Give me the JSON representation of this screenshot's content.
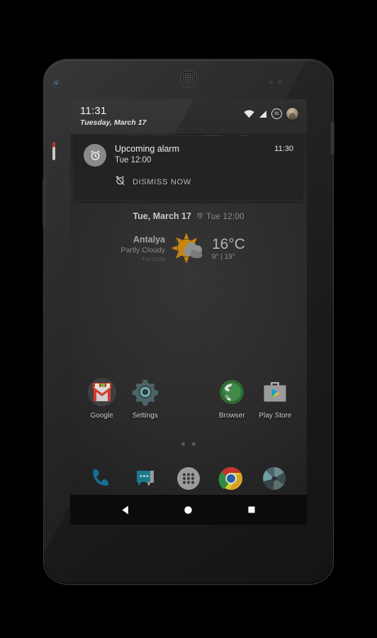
{
  "device": {
    "name": "nexus-5-phone",
    "hardware": [
      "front-camera",
      "earpiece-speaker",
      "proximity-sensor",
      "power-button",
      "volume-button",
      "notification-led"
    ]
  },
  "status_bar": {
    "time": "11:31",
    "date": "Tuesday, March 17",
    "icons": {
      "wifi": "wifi-icon",
      "signal": "cell-signal-icon",
      "battery": "battery-circle-icon",
      "battery_level": "91",
      "avatar": "user-avatar"
    }
  },
  "clock_widget": {
    "time": "11:31"
  },
  "notification": {
    "icon": "alarm-clock-icon",
    "title": "Upcoming alarm",
    "subtitle": "Tue 12:00",
    "timestamp": "11:30",
    "action_icon": "alarm-off-icon",
    "action_label": "DISMISS NOW"
  },
  "date_row": {
    "date": "Tue, March 17",
    "alarm_icon": "alarm-icon",
    "next_alarm": "Tue 12:00"
  },
  "weather": {
    "city": "Antalya",
    "condition": "Partly Cloudy",
    "updated": "Tue 11:03",
    "icon": "sun-behind-cloud-icon",
    "temperature": "16°C",
    "high_low": "9° | 19°",
    "sun_color": "#c6860f",
    "cloud_color": "#8f8f8f"
  },
  "apps": [
    {
      "label": "Google",
      "icon": "gmail-icon"
    },
    {
      "label": "Settings",
      "icon": "settings-gear-icon"
    },
    {
      "label": "",
      "icon": ""
    },
    {
      "label": "Browser",
      "icon": "browser-globe-icon"
    },
    {
      "label": "Play Store",
      "icon": "play-store-icon"
    }
  ],
  "page_indicator": {
    "count": 2,
    "active": 0
  },
  "dock": [
    {
      "icon": "phone-icon",
      "label": "Phone"
    },
    {
      "icon": "messaging-icon",
      "label": "Messaging"
    },
    {
      "icon": "app-drawer-icon",
      "label": "Apps"
    },
    {
      "icon": "chrome-icon",
      "label": "Chrome"
    },
    {
      "icon": "camera-icon",
      "label": "Camera"
    }
  ],
  "nav_bar": [
    {
      "icon": "back-icon",
      "label": "Back"
    },
    {
      "icon": "home-icon",
      "label": "Home"
    },
    {
      "icon": "recents-icon",
      "label": "Recents"
    }
  ]
}
